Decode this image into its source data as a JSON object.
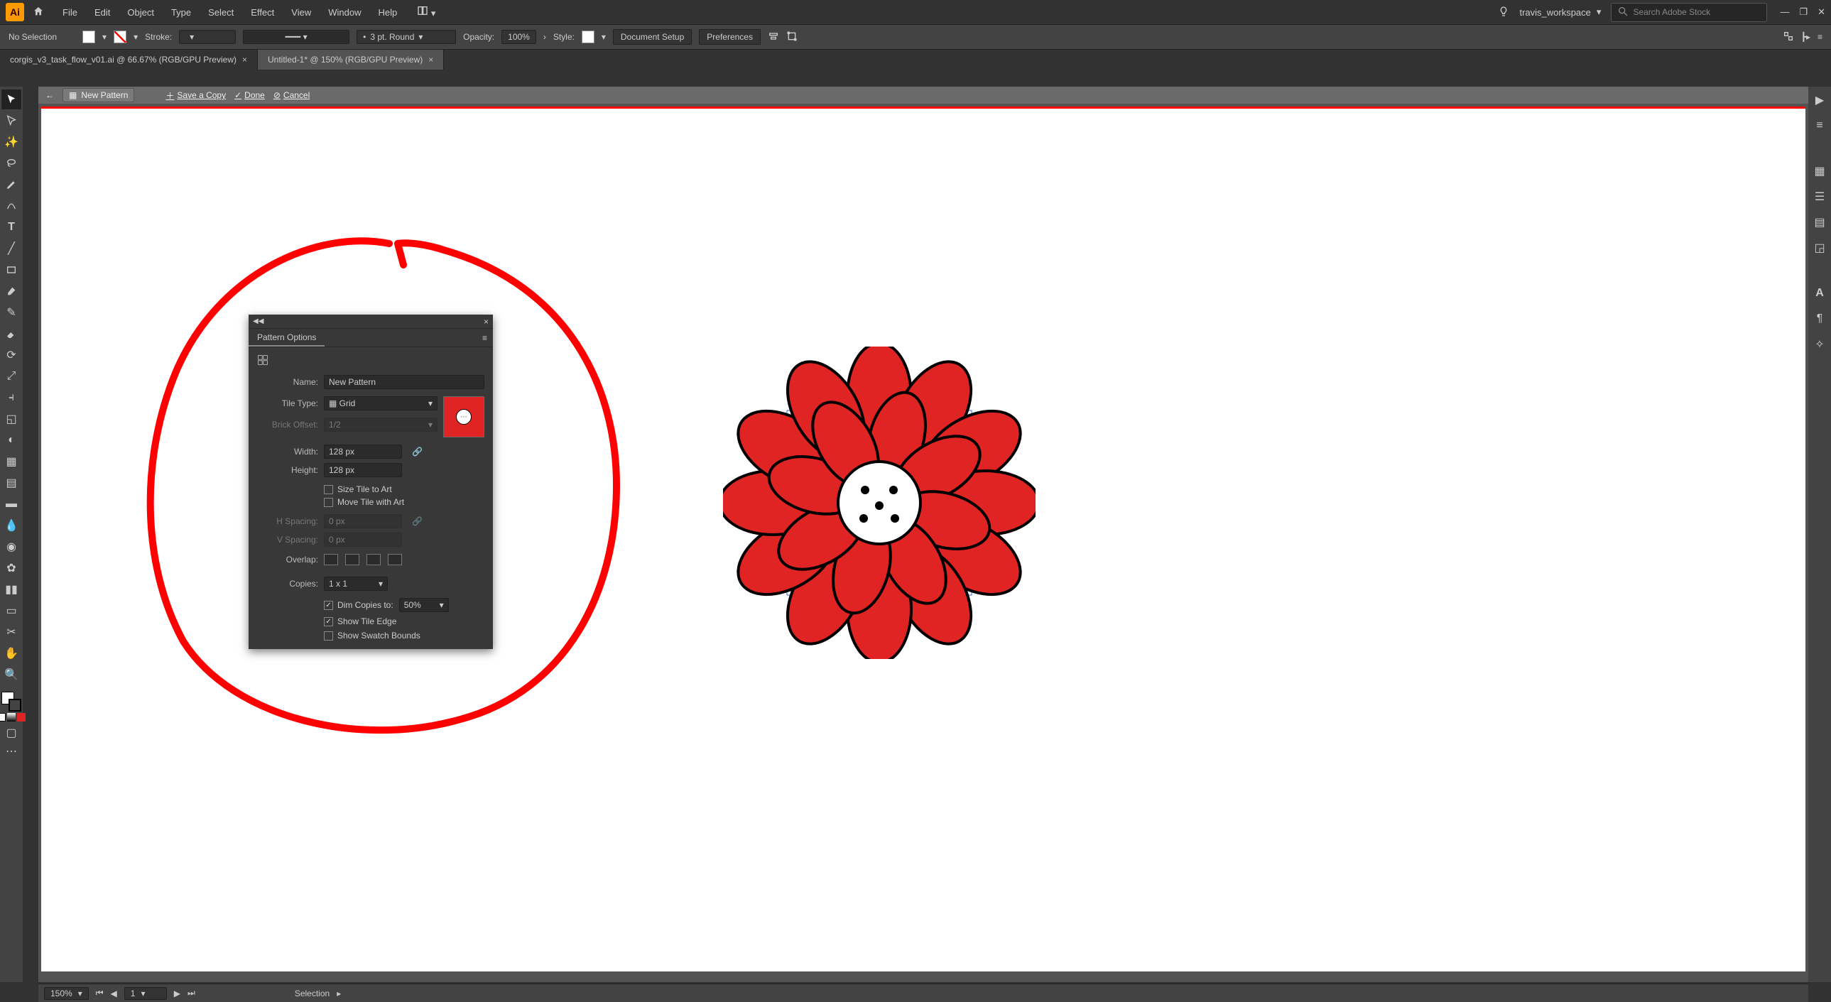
{
  "menubar": {
    "app_abbrev": "Ai",
    "items": [
      "File",
      "Edit",
      "Object",
      "Type",
      "Select",
      "Effect",
      "View",
      "Window",
      "Help"
    ],
    "workspace_label": "travis_workspace",
    "search_placeholder": "Search Adobe Stock"
  },
  "optionsbar": {
    "selection_label": "No Selection",
    "stroke_label": "Stroke:",
    "stroke_weight": "",
    "stroke_profile": "3 pt. Round",
    "opacity_label": "Opacity:",
    "opacity_value": "100%",
    "style_label": "Style:",
    "doc_setup": "Document Setup",
    "preferences": "Preferences"
  },
  "tabs": [
    {
      "label": "corgis_v3_task_flow_v01.ai @ 66.67% (RGB/GPU Preview)",
      "active": false
    },
    {
      "label": "Untitled-1* @ 150% (RGB/GPU Preview)",
      "active": true
    }
  ],
  "editbar": {
    "mode_label": "New Pattern",
    "save_copy": "Save a Copy",
    "done": "Done",
    "cancel": "Cancel"
  },
  "pattern_panel": {
    "title": "Pattern Options",
    "name_label": "Name:",
    "name_value": "New Pattern",
    "tile_type_label": "Tile Type:",
    "tile_type_value": "Grid",
    "brick_offset_label": "Brick Offset:",
    "brick_offset_value": "1/2",
    "width_label": "Width:",
    "width_value": "128 px",
    "height_label": "Height:",
    "height_value": "128 px",
    "size_tile": "Size Tile to Art",
    "move_tile": "Move Tile with Art",
    "h_spacing_label": "H Spacing:",
    "h_spacing_value": "0 px",
    "v_spacing_label": "V Spacing:",
    "v_spacing_value": "0 px",
    "overlap_label": "Overlap:",
    "copies_label": "Copies:",
    "copies_value": "1 x 1",
    "dim_copies": "Dim Copies to:",
    "dim_value": "50%",
    "show_tile": "Show Tile Edge",
    "show_swatch": "Show Swatch Bounds"
  },
  "statusbar": {
    "zoom": "150%",
    "artboard_nav": "1",
    "tool": "Selection"
  }
}
